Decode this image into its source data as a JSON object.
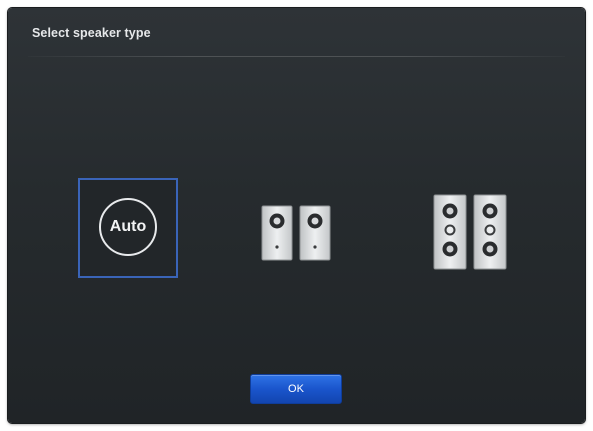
{
  "dialog": {
    "title": "Select speaker type",
    "ok_label": "OK"
  },
  "options": [
    {
      "id": "auto",
      "label": "Auto",
      "icon": "auto-icon",
      "selected": true
    },
    {
      "id": "2ch",
      "icon": "stereo-speakers-icon",
      "selected": false
    },
    {
      "id": "4ch",
      "icon": "quad-speakers-icon",
      "selected": false
    }
  ],
  "colors": {
    "selection_border": "#3a64b8",
    "ok_button": "#1a55cc",
    "background": "#262b2e"
  }
}
